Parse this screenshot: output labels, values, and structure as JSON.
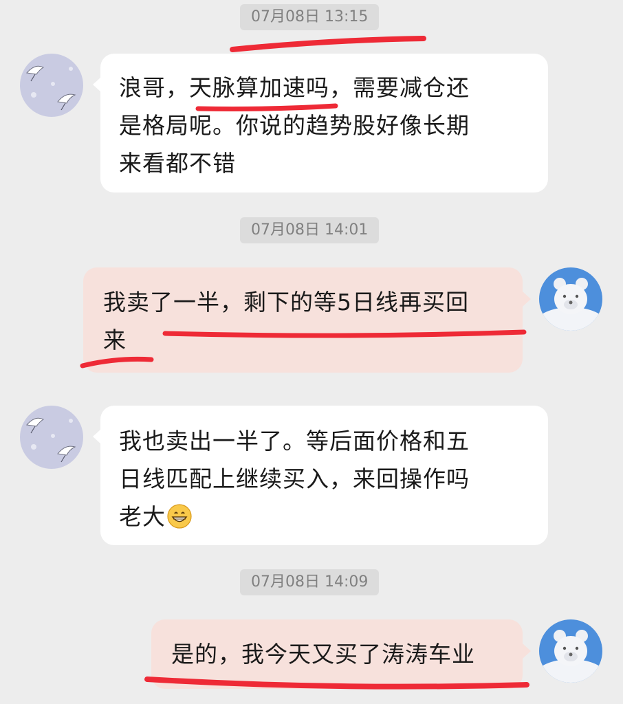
{
  "timestamps": [
    "07月08日 13:15",
    "07月08日 14:01",
    "07月08日 14:09"
  ],
  "messages": [
    {
      "side": "left",
      "lines": [
        "浪哥，天脉算加速吗，需要减仓还",
        "是格局呢。你说的趋势股好像长期",
        "来看都不错"
      ]
    },
    {
      "side": "right",
      "lines": [
        "我卖了一半，剩下的等5日线再买回",
        "来"
      ]
    },
    {
      "side": "left",
      "lines": [
        "我也卖出一半了。等后面价格和五",
        "日线匹配上继续买入，来回操作吗",
        "老大"
      ],
      "emoji": "grinning-face-emoji"
    },
    {
      "side": "right",
      "lines": [
        "是的，我今天又买了涛涛车业"
      ]
    }
  ],
  "colors": {
    "background": "#ededed",
    "bubble_left": "#ffffff",
    "bubble_right": "#f7e1dc",
    "annotation_red": "#ee2a36"
  }
}
